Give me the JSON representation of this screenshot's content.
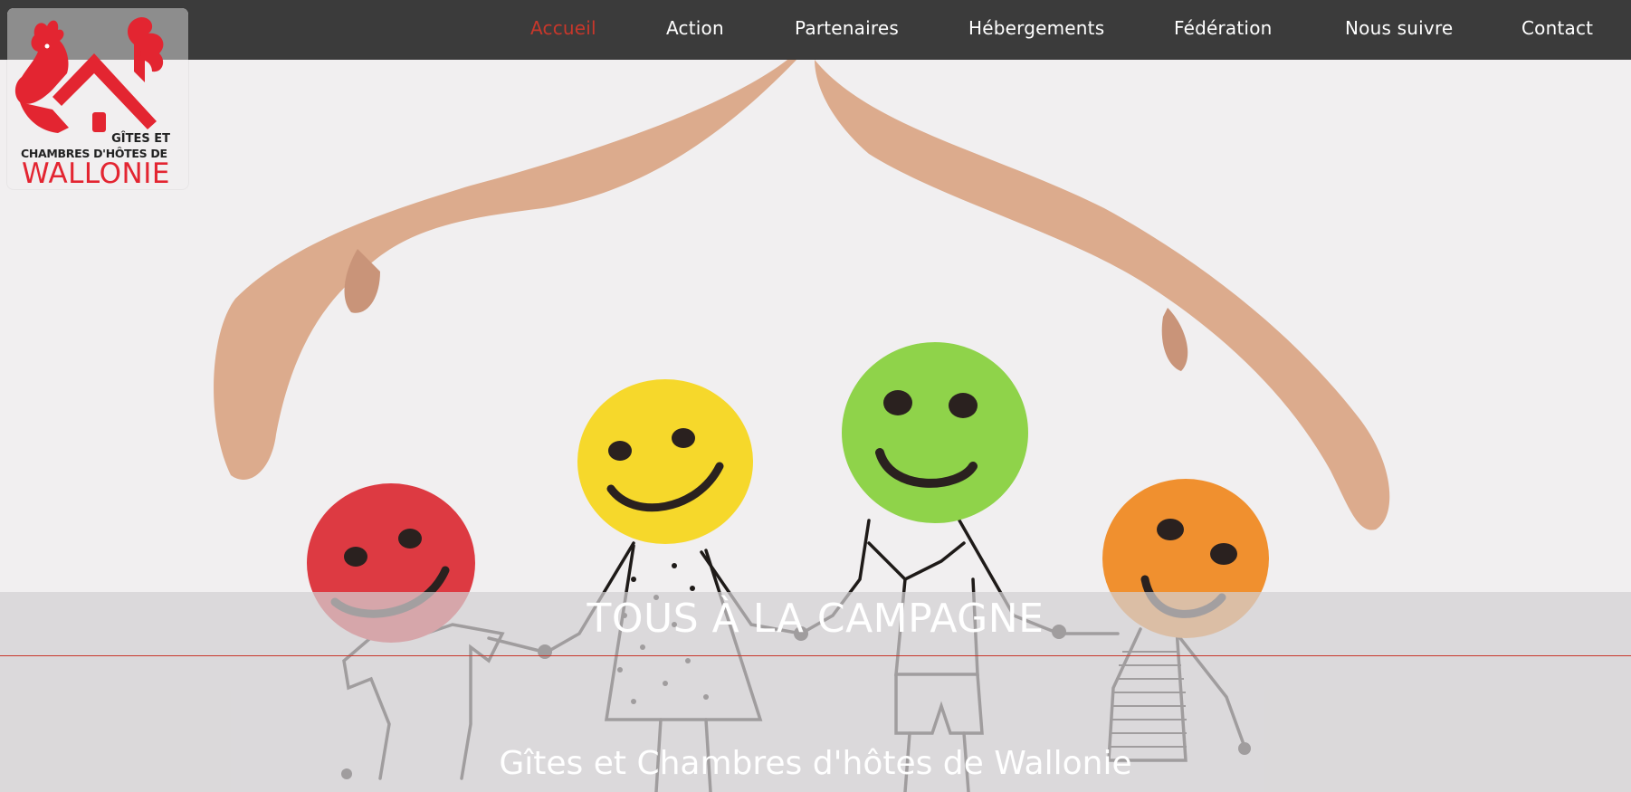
{
  "nav": {
    "items": [
      {
        "label": "Accueil",
        "active": true
      },
      {
        "label": "Action",
        "active": false
      },
      {
        "label": "Partenaires",
        "active": false
      },
      {
        "label": "Hébergements",
        "active": false
      },
      {
        "label": "Fédération",
        "active": false
      },
      {
        "label": "Nous suivre",
        "active": false
      },
      {
        "label": "Contact",
        "active": false
      }
    ]
  },
  "logo": {
    "line1": "GÎTES ET",
    "line2": "CHAMBRES D'HÔTES DE",
    "line3": "WALLONIE"
  },
  "hero": {
    "title": "TOUS À LA CAMPAGNE",
    "subtitle": "Gîtes et Chambres d'hôtes de Wallonie"
  },
  "colors": {
    "nav_bg": "#3b3b3b",
    "accent": "#c8372b",
    "logo_red": "#e32531",
    "background": "#f1eff0"
  }
}
